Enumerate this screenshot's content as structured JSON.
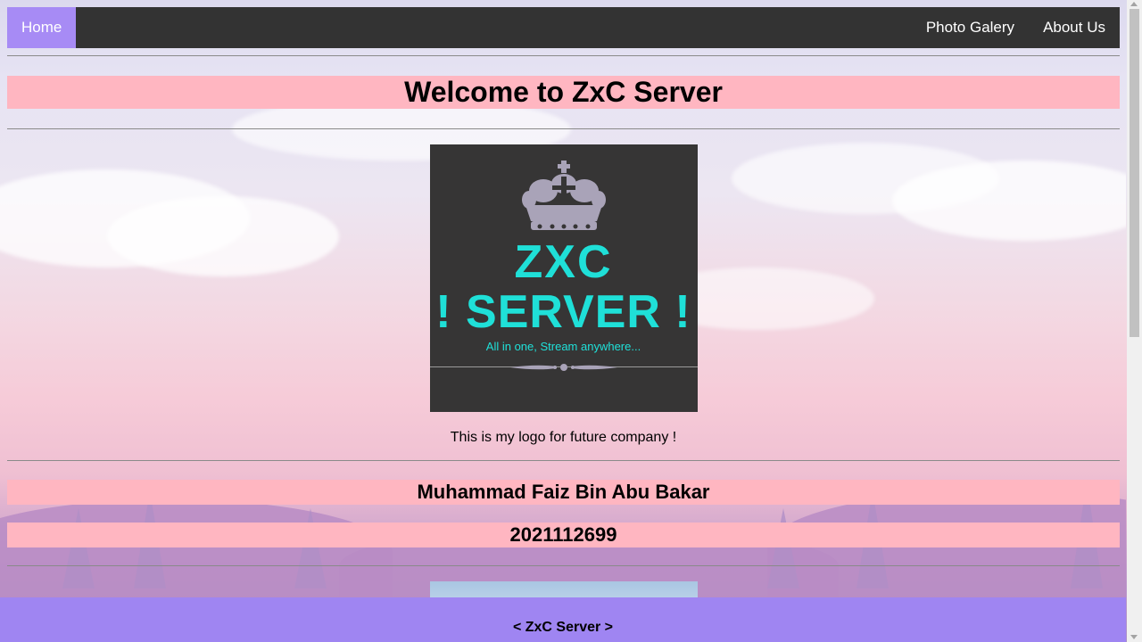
{
  "nav": {
    "home_label": "Home",
    "gallery_label": "Photo Galery",
    "about_label": "About Us"
  },
  "main": {
    "title": "Welcome to ZxC Server",
    "logo": {
      "line1": "ZXC",
      "line2": "! SERVER !",
      "tagline": "All in one, Stream anywhere..."
    },
    "caption": "This is my logo for future company !",
    "name": "Muhammad Faiz Bin Abu Bakar",
    "student_id": "2021112699"
  },
  "footer": {
    "text": "< ZxC Server >"
  },
  "colors": {
    "nav_bg": "#333333",
    "nav_active": "#a78bf5",
    "heading_bg": "#ffb6c1",
    "logo_bg": "#363535",
    "logo_text": "#1fe0d8",
    "footer_bg": "#9f85f2"
  }
}
